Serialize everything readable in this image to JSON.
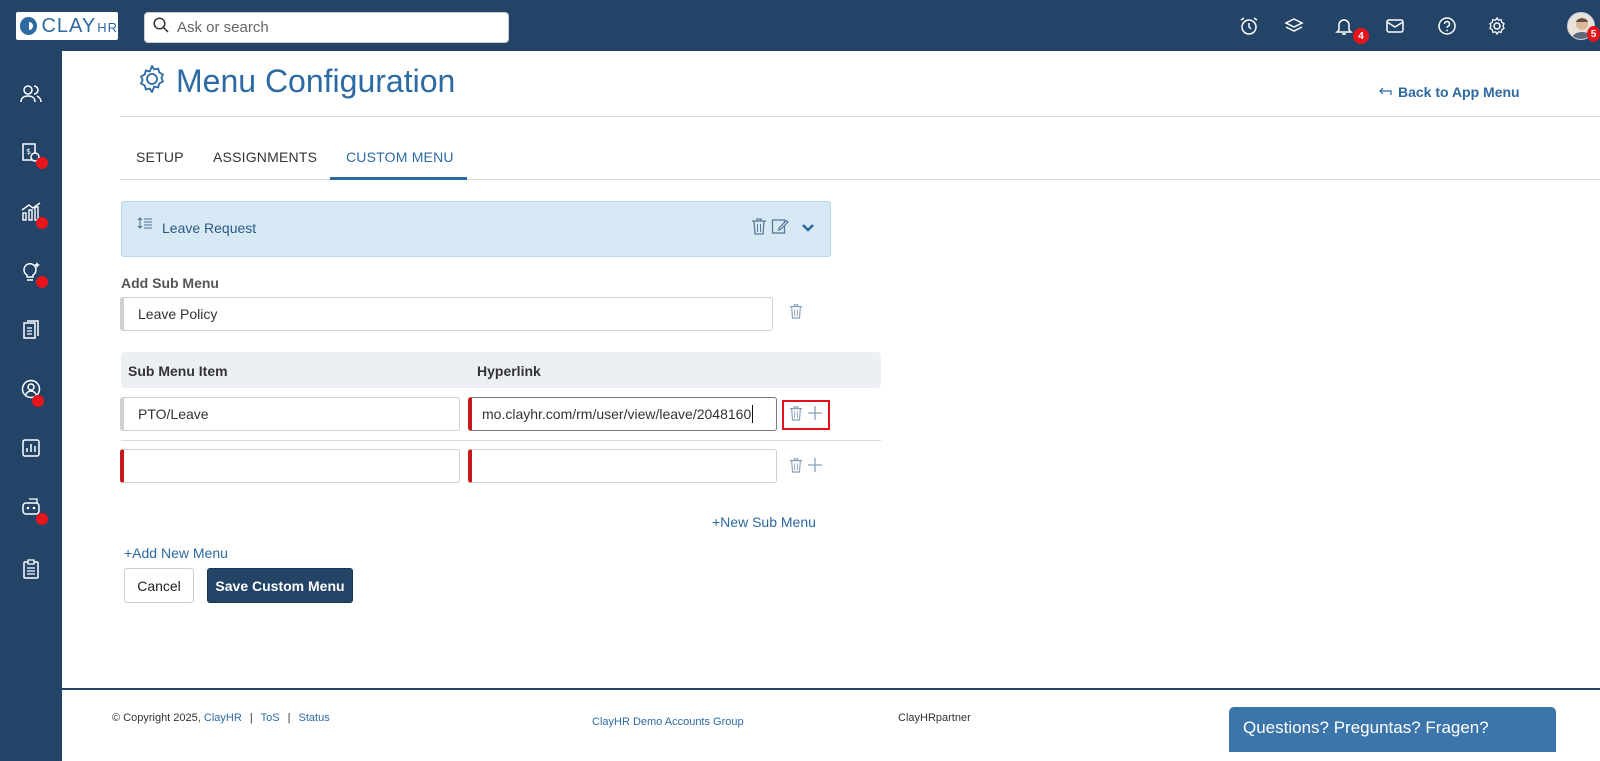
{
  "header": {
    "logo_text": "CLAY",
    "logo_suffix": "HR",
    "search_placeholder": "Ask or search",
    "notification_count": "4",
    "avatar_badge": "5"
  },
  "page": {
    "title": "Menu Configuration",
    "back_link": "Back to App Menu"
  },
  "tabs": [
    {
      "label": "SETUP",
      "active": false
    },
    {
      "label": "ASSIGNMENTS",
      "active": false
    },
    {
      "label": "CUSTOM MENU",
      "active": true
    }
  ],
  "menu_card": {
    "label": "Leave Request"
  },
  "sub_menu": {
    "section_label": "Add Sub Menu",
    "name_value": "Leave Policy",
    "columns": [
      "Sub Menu Item",
      "Hyperlink"
    ],
    "rows": [
      {
        "item": "PTO/Leave",
        "hyperlink": "mo.clayhr.com/rm/user/view/leave/2048160"
      },
      {
        "item": "",
        "hyperlink": ""
      }
    ],
    "new_sub_menu": "+New Sub Menu"
  },
  "actions": {
    "add_new_menu": "+Add New Menu",
    "cancel": "Cancel",
    "save": "Save Custom Menu"
  },
  "footer": {
    "copyright": "© Copyright 2025,",
    "brand_link": "ClayHR",
    "sep": "|",
    "tos": "ToS",
    "status": "Status",
    "group": "ClayHR Demo Accounts Group",
    "partner": "ClayHRpartner",
    "chat": "Questions? Preguntas? Fragen?"
  },
  "colors": {
    "navy": "#234467",
    "accent": "#2c6aa3",
    "badge_red": "#e8141b",
    "required_red": "#c21a1a"
  }
}
